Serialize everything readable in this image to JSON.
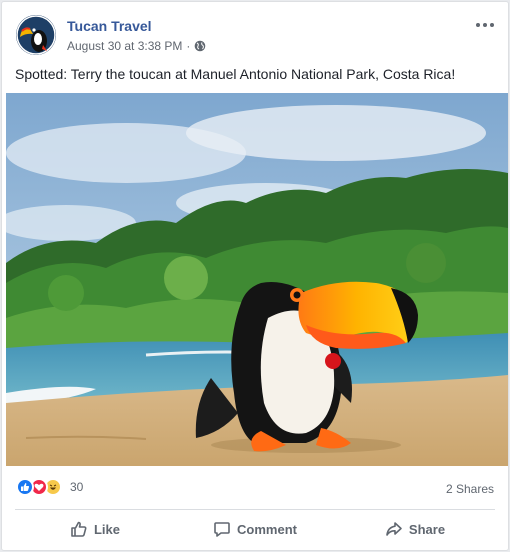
{
  "post": {
    "page_name": "Tucan Travel",
    "timestamp": "August 30 at 3:38 PM",
    "separator": "·",
    "audience_icon": "globe-icon",
    "text": "Spotted: Terry the toucan at Manuel Antonio National Park, Costa Rica!"
  },
  "stats": {
    "reaction_icons": [
      "like-reaction-icon",
      "love-reaction-icon",
      "haha-reaction-icon"
    ],
    "reaction_count": "30",
    "shares": "2 Shares"
  },
  "actions": {
    "like": "Like",
    "comment": "Comment",
    "share": "Share"
  },
  "colors": {
    "link_blue": "#365899",
    "meta_gray": "#616770",
    "like_blue": "#1877f2",
    "love_red": "#f0284a",
    "haha_yellow": "#f7c94b"
  }
}
